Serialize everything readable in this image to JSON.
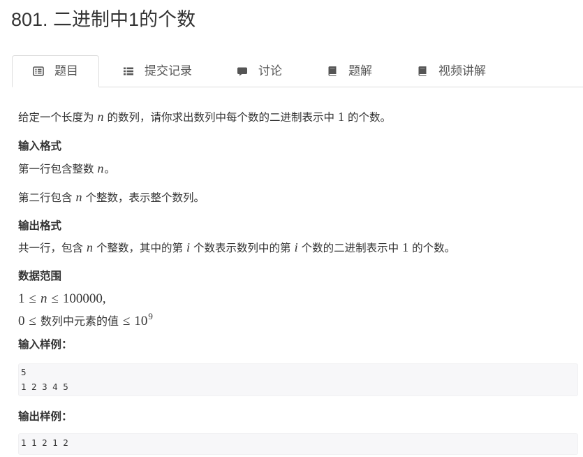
{
  "page": {
    "title": "801. 二进制中1的个数"
  },
  "tabs": [
    {
      "label": "题目",
      "icon": "list-alt-icon",
      "active": true
    },
    {
      "label": "提交记录",
      "icon": "list-icon",
      "active": false
    },
    {
      "label": "讨论",
      "icon": "comment-icon",
      "active": false
    },
    {
      "label": "题解",
      "icon": "book-icon",
      "active": false
    },
    {
      "label": "视频讲解",
      "icon": "book-icon",
      "active": false
    }
  ],
  "problem": {
    "description": {
      "t1": "给定一个长度为",
      "m1": "n",
      "t2": "的数列，请你求出数列中每个数的二进制表示中",
      "m2": "1",
      "t3": "的个数。"
    },
    "input_format": {
      "heading": "输入格式",
      "line1": {
        "t1": "第一行包含整数",
        "m1": "n",
        "t2": "。"
      },
      "line2": {
        "t1": "第二行包含",
        "m1": "n",
        "t2": "个整数，表示整个数列。"
      }
    },
    "output_format": {
      "heading": "输出格式",
      "line1": {
        "t1": "共一行，包含",
        "m1": "n",
        "t2": "个整数，其中的第",
        "m2": "i",
        "t3": "个数表示数列中的第",
        "m3": "i",
        "t4": "个数的二进制表示中",
        "m4": "1",
        "t5": "的个数。"
      }
    },
    "data_range": {
      "heading": "数据范围",
      "line1": {
        "a": "1",
        "op1": "≤",
        "var": "n",
        "op2": "≤",
        "b": "100000",
        "punct": ","
      },
      "line2": {
        "a": "0",
        "op1": "≤",
        "text": "数列中元素的值",
        "op2": "≤",
        "base": "10",
        "exp": "9"
      }
    },
    "sample_input": {
      "heading": "输入样例：",
      "code": "5\n1 2 3 4 5"
    },
    "sample_output": {
      "heading": "输出样例：",
      "code": "1 1 2 1 2"
    }
  },
  "colors": {
    "text": "#333333",
    "tab_text": "#555555",
    "border": "#dddddd",
    "code_bg": "#f7f7f9"
  }
}
